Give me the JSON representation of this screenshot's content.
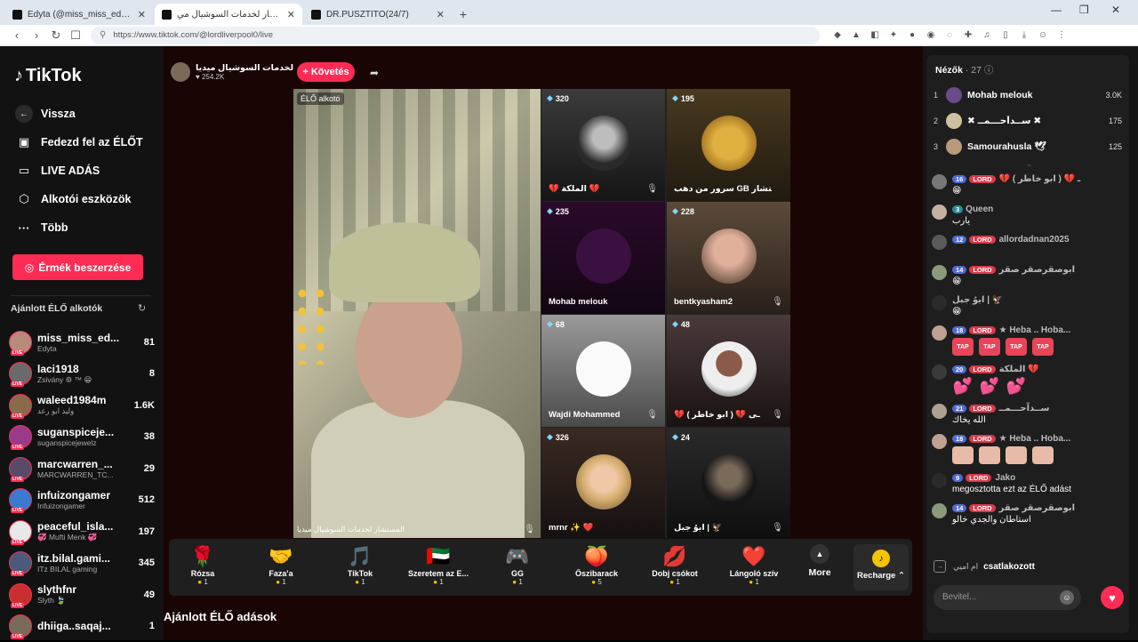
{
  "browser": {
    "tabs": [
      {
        "title": "Edyta (@miss_miss_edyta) ÉLŐ adá",
        "active": false
      },
      {
        "title": "المستشار لخدمات السوشيال مي",
        "active": true
      },
      {
        "title": "DR.PUSZTÍTÓ(24/7)",
        "active": false
      }
    ],
    "url": "https://www.tiktok.com/@lordliverpool0/live"
  },
  "sidebar": {
    "logo": "TikTok",
    "nav": [
      {
        "label": "Vissza",
        "icon": "back-icon"
      },
      {
        "label": "Fedezd fel az ÉLŐT",
        "icon": "explore-live-icon"
      },
      {
        "label": "LIVE ADÁS",
        "icon": "video-camera-icon"
      },
      {
        "label": "Alkotói eszközök",
        "icon": "creator-tools-icon"
      },
      {
        "label": "Több",
        "icon": "more-dots-icon"
      }
    ],
    "coins_button": "Érmék beszerzése",
    "recommended_title": "Ajánlott ÉLŐ alkotók",
    "creators": [
      {
        "name": "miss_miss_ed...",
        "sub": "Edyta",
        "count": "81"
      },
      {
        "name": "laci1918",
        "sub": "Zsivány ⚙ ™ 😁",
        "count": "8"
      },
      {
        "name": "waleed1984m",
        "sub": "وليد ابو رعد",
        "count": "1.6K"
      },
      {
        "name": "suganspiceje...",
        "sub": "suganspicejewelz",
        "count": "38"
      },
      {
        "name": "marcwarren_...",
        "sub": "MARCWARREN_TC...",
        "count": "29"
      },
      {
        "name": "infuizongamer",
        "sub": "Infuizongamer",
        "count": "512"
      },
      {
        "name": "peaceful_isla...",
        "sub": "💞 Mufti Menk 💞",
        "count": "197"
      },
      {
        "name": "itz.bilal.gami...",
        "sub": "ITz BILAL gaming",
        "count": "345"
      },
      {
        "name": "slythfnr",
        "sub": "Slyth 🍃",
        "count": "49"
      },
      {
        "name": "dhiiga..saqaj...",
        "sub": "",
        "count": "1"
      }
    ]
  },
  "host": {
    "name": "المستشار لخدمات السوشيال ميديا",
    "likes": "254.2K",
    "follow_label": "+ Követés",
    "badge": "ÉLŐ alkotó",
    "caption": "المستشار لخدمات السوشيال ميديا"
  },
  "guests": [
    {
      "count": "320",
      "name": "💔 الملكة 💔"
    },
    {
      "count": "195",
      "name": "سرور من دهب GB المستشار"
    },
    {
      "count": "235",
      "name": "Mohab melouk"
    },
    {
      "count": "228",
      "name": "bentkyasham2"
    },
    {
      "count": "68",
      "name": "Wajdi Mohammed"
    },
    {
      "count": "48",
      "name": "💔 ( ابو خاطر ) 💔 ـى"
    },
    {
      "count": "326",
      "name": "mrnr ✨ ❤️"
    },
    {
      "count": "24",
      "name": "ابوُ جبل | 🦅"
    }
  ],
  "gifts": [
    {
      "name": "Rózsa",
      "price": "1",
      "icon": "🌹"
    },
    {
      "name": "Faza'a",
      "price": "1",
      "icon": "🤝"
    },
    {
      "name": "TikTok",
      "price": "1",
      "icon": "🎵"
    },
    {
      "name": "Szeretem az E...",
      "price": "1",
      "icon": "🇦🇪"
    },
    {
      "name": "GG",
      "price": "1",
      "icon": "🎮"
    },
    {
      "name": "Őszibarack",
      "price": "5",
      "icon": "🍑"
    },
    {
      "name": "Dobj csókot",
      "price": "1",
      "icon": "💋"
    },
    {
      "name": "Lángoló szív",
      "price": "1",
      "icon": "❤️"
    }
  ],
  "more_label": "More",
  "recharge_label": "Recharge",
  "recommended_live": "Ajánlott ÉLŐ adások",
  "chat": {
    "viewers_label": "Nézők",
    "viewers_count": "27",
    "top": [
      {
        "rank": "1",
        "name": "Mohab melouk",
        "points": "3.0K"
      },
      {
        "rank": "2",
        "name": "✖ ســدآحـــمــ ✖",
        "points": "175"
      },
      {
        "rank": "3",
        "name": "Samourahusla 🕊",
        "points": "125"
      }
    ],
    "messages": [
      {
        "level": "16",
        "lord": "LORD",
        "user": "💔 ( ابو خاطر ) 💔 ـ",
        "text": "😁"
      },
      {
        "level": "3",
        "lord": "",
        "user": "Queen",
        "text": "يارب"
      },
      {
        "level": "12",
        "lord": "LORD",
        "user": "allordadnan2025",
        "text": ""
      },
      {
        "level": "14",
        "lord": "LORD",
        "user": "ابوصقرصقر صقر",
        "text": "😁"
      },
      {
        "level": "",
        "lord": "",
        "user": "ابوُ جبل | 🦅",
        "text": "😁"
      },
      {
        "level": "18",
        "lord": "LORD",
        "user": "★ Heba .. Hoba...",
        "text": ""
      },
      {
        "level": "20",
        "lord": "LORD",
        "user": "الملكة 💔",
        "text": ""
      },
      {
        "level": "21",
        "lord": "LORD",
        "user": "ســدآحـــمــ",
        "text": "الله يخاك"
      },
      {
        "level": "18",
        "lord": "LORD",
        "user": "★ Heba .. Hoba...",
        "text": ""
      },
      {
        "level": "9",
        "lord": "LORD",
        "user": "Jako",
        "text": "megosztotta ezt az ÉLŐ adást"
      },
      {
        "level": "14",
        "lord": "LORD",
        "user": "ابوصقرصقر صقر",
        "text": "استاطان والجدي خالو"
      }
    ],
    "join_user": "ام اميي",
    "join_text": "csatlakozott",
    "input_placeholder": "Bevitel..."
  }
}
